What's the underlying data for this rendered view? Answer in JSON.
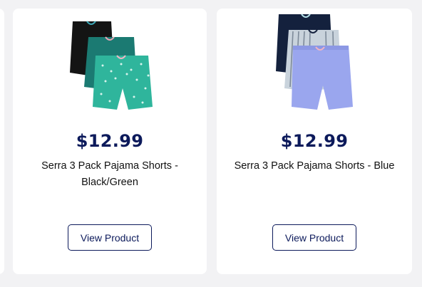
{
  "products": [
    {
      "price": "$12.99",
      "title": "Serra 3 Pack Pajama Shorts - Black/Green",
      "button_label": "View Product",
      "image_icon": "pajama-shorts-black-green-image",
      "colors": [
        "#141414",
        "#1b7a72",
        "#2fb59c"
      ]
    },
    {
      "price": "$12.99",
      "title": "Serra 3 Pack Pajama Shorts - Blue",
      "button_label": "View Product",
      "image_icon": "pajama-shorts-blue-image",
      "colors": [
        "#14213d",
        "#c9d3dc",
        "#9aa6ee"
      ]
    }
  ],
  "colors": {
    "price": "#0c1a5b",
    "button_border": "#0c1a5b",
    "page_background": "#f2f2f4"
  }
}
